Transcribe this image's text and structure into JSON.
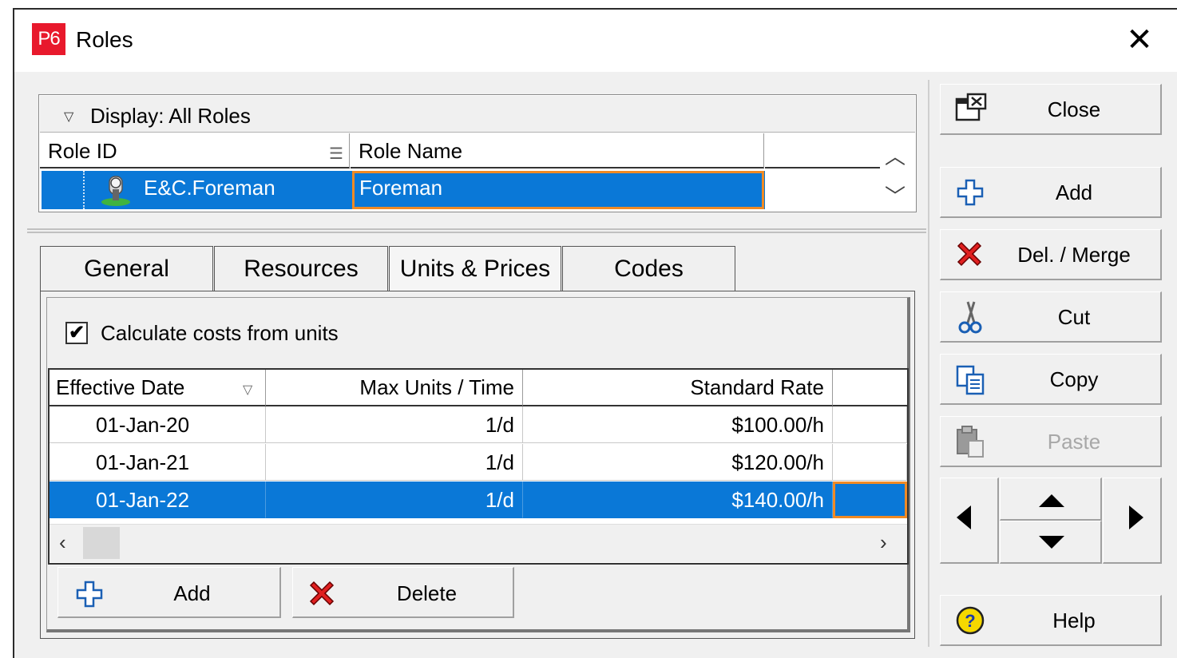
{
  "window": {
    "logo": "P6",
    "title": "Roles",
    "close_glyph": "✕"
  },
  "roles": {
    "display_label": "Display: All Roles",
    "columns": [
      "Role ID",
      "Role Name"
    ],
    "selected_row": {
      "role_id": "E&C.Foreman",
      "role_name": "Foreman"
    }
  },
  "tabs": [
    {
      "label": "General"
    },
    {
      "label": "Resources"
    },
    {
      "label": "Units & Prices",
      "active": true
    },
    {
      "label": "Codes"
    }
  ],
  "units_prices": {
    "calc_checkbox_label": "Calculate costs from units",
    "calc_checked": true,
    "columns": [
      "Effective Date",
      "Max Units / Time",
      "Standard Rate"
    ],
    "rows": [
      {
        "date": "01-Jan-20",
        "max_units": "1/d",
        "rate": "$100.00/h"
      },
      {
        "date": "01-Jan-21",
        "max_units": "1/d",
        "rate": "$120.00/h"
      },
      {
        "date": "01-Jan-22",
        "max_units": "1/d",
        "rate": "$140.00/h"
      }
    ],
    "selected_row_index": 2,
    "add_label": "Add",
    "delete_label": "Delete"
  },
  "side_buttons": {
    "close": "Close",
    "add": "Add",
    "del_merge": "Del. / Merge",
    "cut": "Cut",
    "copy": "Copy",
    "paste": "Paste",
    "help": "Help"
  },
  "colors": {
    "selection": "#0a78d7",
    "focus_border": "#f08a24",
    "logo_bg": "#e8192c"
  }
}
